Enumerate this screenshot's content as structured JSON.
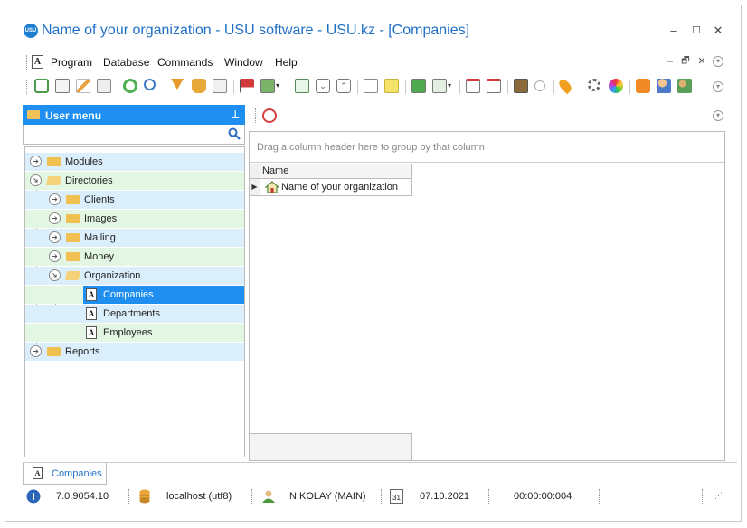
{
  "window": {
    "title": "Name of your organization - USU software - USU.kz - [Companies]",
    "logo_text": "USU",
    "controls": {
      "minimize": "–",
      "maximize": "☐",
      "close": "✕"
    }
  },
  "menubar": {
    "doc_icon": "A",
    "items": [
      "Program",
      "Database",
      "Commands",
      "Window",
      "Help"
    ],
    "mdi_controls": {
      "minimize": "–",
      "restore": "🗗",
      "close": "✕"
    }
  },
  "colors": {
    "accent": "#1e8ff0",
    "row_blue": "#dbeefb",
    "row_green": "#e3f5e3",
    "selected": "#1e8ff0"
  },
  "left_panel": {
    "title": "User menu",
    "pin": "ᚁ",
    "search_value": "",
    "tree": [
      {
        "label": "Modules",
        "icon": "folder-closed-icon",
        "expand": "collapsed"
      },
      {
        "label": "Directories",
        "icon": "folder-open-icon",
        "expand": "expanded"
      },
      {
        "label": "Clients",
        "icon": "folder-closed-icon",
        "expand": "collapsed"
      },
      {
        "label": "Images",
        "icon": "folder-closed-icon",
        "expand": "collapsed"
      },
      {
        "label": "Mailing",
        "icon": "folder-closed-icon",
        "expand": "collapsed"
      },
      {
        "label": "Money",
        "icon": "folder-closed-icon",
        "expand": "collapsed"
      },
      {
        "label": "Organization",
        "icon": "folder-open-icon",
        "expand": "expanded"
      },
      {
        "label": "Companies",
        "icon": "document-icon",
        "selected": true
      },
      {
        "label": "Departments",
        "icon": "document-icon"
      },
      {
        "label": "Employees",
        "icon": "document-icon"
      },
      {
        "label": "Reports",
        "icon": "folder-closed-icon",
        "expand": "collapsed"
      }
    ]
  },
  "grid": {
    "group_hint": "Drag a column header here to group by that column",
    "columns": [
      "Name"
    ],
    "rows": [
      [
        "Name of your organization"
      ]
    ]
  },
  "tabs": [
    {
      "label": "Companies",
      "icon": "A"
    }
  ],
  "statusbar": {
    "version": "7.0.9054.10",
    "db": "localhost (utf8)",
    "user": "NIKOLAY (MAIN)",
    "calendar_day": "31",
    "date": "07.10.2021",
    "timer": "00:00:00:004"
  }
}
